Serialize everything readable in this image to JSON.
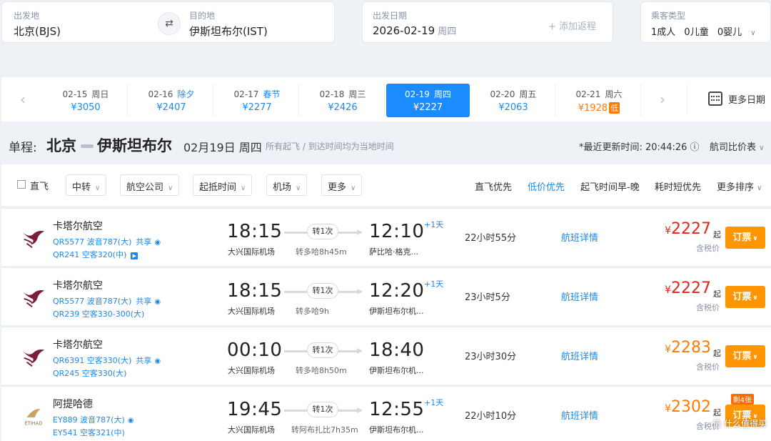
{
  "search": {
    "from_label": "出发地",
    "from_value": "北京(BJS)",
    "to_label": "目的地",
    "to_value": "伊斯坦布尔(IST)",
    "date_label": "出发日期",
    "date_value": "2026-02-19",
    "date_week": "周四",
    "add_return": "+ 添加返程",
    "pax_label": "乘客类型",
    "pax_adult": "1成人",
    "pax_child": "0儿童",
    "pax_infant": "0婴儿"
  },
  "date_strip": {
    "items": [
      {
        "date": "02-15",
        "tag": "周日",
        "holiday": "",
        "price": "¥3050"
      },
      {
        "date": "02-16",
        "tag": "",
        "holiday": "除夕",
        "price": "¥2407"
      },
      {
        "date": "02-17",
        "tag": "",
        "holiday": "春节",
        "price": "¥2277"
      },
      {
        "date": "02-18",
        "tag": "周三",
        "holiday": "",
        "price": "¥2426"
      },
      {
        "date": "02-19",
        "tag": "周四",
        "holiday": "",
        "price": "¥2227"
      },
      {
        "date": "02-20",
        "tag": "周五",
        "holiday": "",
        "price": "¥2063"
      },
      {
        "date": "02-21",
        "tag": "周六",
        "holiday": "",
        "price": "¥1928",
        "low_tag": "低"
      }
    ],
    "more_dates": "更多日期"
  },
  "title": {
    "lead": "单程:",
    "from_city": "北京",
    "to_city": "伊斯坦布尔",
    "date": "02月19日 周四",
    "note": "所有起飞 / 到达时间均为当地时间",
    "updated": "*最近更新时间: 20:44:26 ⓘ",
    "compare": "航司比价表"
  },
  "filters": {
    "direct": "直飞",
    "transfer": "中转",
    "airline": "航空公司",
    "time": "起抵时间",
    "airport": "机场",
    "more": "更多"
  },
  "sorts": [
    "直飞优先",
    "低价优先",
    "起飞时间早-晚",
    "耗时短优先",
    "更多排序"
  ],
  "flights": [
    {
      "airline": "卡塔尔航空",
      "fno1": "QR5577 波音787(大)",
      "share1": "共享",
      "fno2": "QR241 空客320(中)",
      "dep": "18:15",
      "dep_ap": "大兴国际机场",
      "stops": "转1次",
      "via": "转多哈8h45m",
      "arr": "12:10",
      "plus": "+1天",
      "arr_ap": "萨比哈·格克...",
      "dur": "22小时55分",
      "detail": "航班详情",
      "price": "2227",
      "qi": "起",
      "tax": "含税价",
      "book": "订票"
    },
    {
      "airline": "卡塔尔航空",
      "fno1": "QR5577 波音787(大)",
      "share1": "共享",
      "fno2": "QR239 空客330-300(大)",
      "dep": "18:15",
      "dep_ap": "大兴国际机场",
      "stops": "转1次",
      "via": "转多哈9h",
      "arr": "12:20",
      "plus": "+1天",
      "arr_ap": "伊斯坦布尔机...",
      "dur": "23小时5分",
      "detail": "航班详情",
      "price": "2227",
      "qi": "起",
      "tax": "含税价",
      "book": "订票"
    },
    {
      "airline": "卡塔尔航空",
      "fno1": "QR6391 空客330(大)",
      "share1": "共享",
      "fno2": "QR245 空客330(大)",
      "dep": "00:10",
      "dep_ap": "大兴国际机场",
      "stops": "转1次",
      "via": "转多哈8h50m",
      "arr": "18:40",
      "plus": "",
      "arr_ap": "伊斯坦布尔机...",
      "dur": "23小时30分",
      "detail": "航班详情",
      "price": "2283",
      "qi": "起",
      "tax": "含税价",
      "book": "订票"
    },
    {
      "airline": "阿提哈德",
      "fno1": "EY889 波音787(大)",
      "share1": "",
      "fno2": "EY541 空客321(中)",
      "dep": "19:45",
      "dep_ap": "大兴国际机场",
      "stops": "转1次",
      "via": "转阿布扎比7h35m",
      "arr": "12:55",
      "plus": "+1天",
      "arr_ap": "伊斯坦布尔机...",
      "dur": "22小时10分",
      "detail": "航班详情",
      "price": "2302",
      "qi": "起",
      "tax": "含税价",
      "book": "订票",
      "badge": "剩4张"
    }
  ],
  "watermark": "值 什么值得买",
  "colors": {
    "accent": "#1a8cff",
    "price_red": "#e5251b",
    "price_orange": "#ff7a00",
    "book": "#ff9500"
  }
}
